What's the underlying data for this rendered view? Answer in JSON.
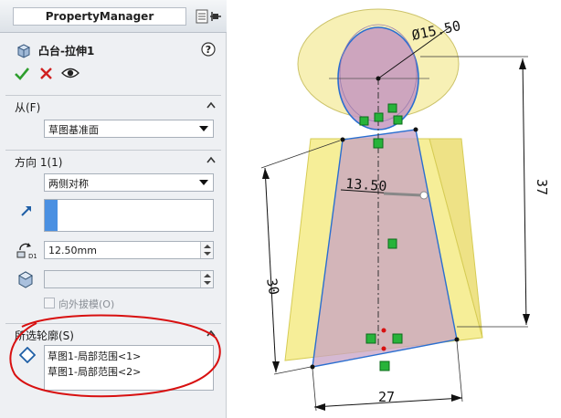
{
  "panel": {
    "title": "PropertyManager",
    "feature_name": "凸台-拉伸1",
    "help": "?"
  },
  "from": {
    "header": "从(F)",
    "value": "草图基准面"
  },
  "direction1": {
    "header": "方向 1(1)",
    "end_condition": "两侧对称",
    "depth": "12.50mm",
    "draft_outward_label": "向外拔模(O)"
  },
  "selected_contours": {
    "header": "所选轮廓(S)",
    "items": [
      "草图1-局部范围<1>",
      "草图1-局部范围<2>"
    ]
  },
  "viewport": {
    "dims": {
      "diameter": "Ø15.50",
      "width_top": "13.50",
      "width_bottom": "27",
      "height_left": "30",
      "height_right": "37"
    }
  },
  "colors": {
    "accept_green": "#2e9e2e",
    "cancel_red": "#d02020",
    "annotation_red": "#d81010",
    "direction_blue": "#4a90e2",
    "body_yellow": "#f6ee98",
    "profile_pink": "#c7a2c4"
  },
  "icons": [
    "extrude-feature-icon",
    "help-icon",
    "check-icon",
    "close-icon",
    "eye-icon",
    "pin-icon",
    "direction-arrow-icon",
    "depth-icon",
    "draft-icon",
    "contour-diamond-icon"
  ]
}
